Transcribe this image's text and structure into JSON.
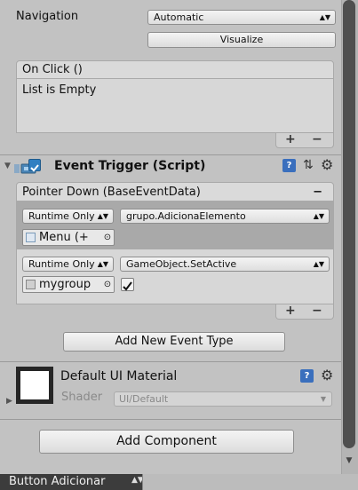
{
  "navigation": {
    "label": "Navigation",
    "mode_value": "Automatic",
    "visualize_label": "Visualize"
  },
  "on_click": {
    "header": "On Click ()",
    "empty_text": "List is Empty",
    "plus": "+",
    "minus": "−"
  },
  "event_trigger": {
    "title": "Event Trigger (Script)",
    "pointer_down": {
      "header": "Pointer Down (BaseEventData)",
      "minus": "−",
      "entries": [
        {
          "runtime": "Runtime Only",
          "function": "grupo.AdicionaElemento",
          "object": "Menu (+"
        },
        {
          "runtime": "Runtime Only",
          "function": "GameObject.SetActive",
          "object": "mygroup",
          "checked": true
        }
      ],
      "plus": "+",
      "minus_footer": "−"
    },
    "add_event_type_label": "Add New Event Type"
  },
  "material": {
    "name": "Default UI Material",
    "shader_label": "Shader",
    "shader_value": "UI/Default"
  },
  "add_component_label": "Add Component",
  "status_bar": {
    "object_name": "Button Adicionar"
  },
  "colors": {
    "background": "#c2c2c2",
    "panel": "#d7d7d7",
    "status_bar": "#3c3c3c",
    "scroll_thumb": "#4f4f4f"
  }
}
